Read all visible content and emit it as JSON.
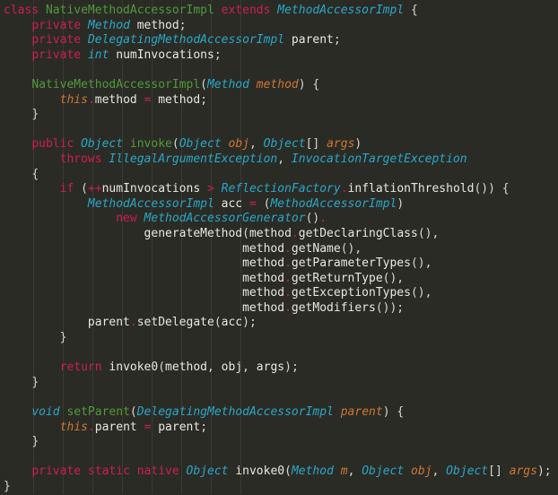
{
  "editor": {
    "background": "#2b2b26",
    "language": "java",
    "class_name": "NativeMethodAccessorImpl",
    "colors": {
      "background": "#2b2b26",
      "keyword": "#cc1f4f",
      "type": "#29a8c7",
      "method_declaration": "#4e9a3a",
      "parameter": "#cc7832",
      "plain_text": "#e8e8e0",
      "operator": "#cc1f4f",
      "indent_guide": "#3a3a33"
    },
    "indent_guide_columns": [
      4,
      8,
      12,
      16,
      20,
      24,
      28,
      32
    ]
  },
  "lines": [
    [
      [
        "kw",
        "class"
      ],
      [
        "tx",
        " "
      ],
      [
        "fn",
        "NativeMethodAccessorImpl"
      ],
      [
        "tx",
        " "
      ],
      [
        "kw",
        "extends"
      ],
      [
        "tx",
        " "
      ],
      [
        "ty",
        "MethodAccessorImpl"
      ],
      [
        "tx",
        " "
      ],
      [
        "pn",
        "{"
      ]
    ],
    [
      [
        "tx",
        "    "
      ],
      [
        "kw",
        "private"
      ],
      [
        "tx",
        " "
      ],
      [
        "ty",
        "Method"
      ],
      [
        "tx",
        " method"
      ],
      [
        "pn",
        ";"
      ]
    ],
    [
      [
        "tx",
        "    "
      ],
      [
        "kw",
        "private"
      ],
      [
        "tx",
        " "
      ],
      [
        "ty",
        "DelegatingMethodAccessorImpl"
      ],
      [
        "tx",
        " parent"
      ],
      [
        "pn",
        ";"
      ]
    ],
    [
      [
        "tx",
        "    "
      ],
      [
        "kw",
        "private"
      ],
      [
        "tx",
        " "
      ],
      [
        "ty",
        "int"
      ],
      [
        "tx",
        " numInvocations"
      ],
      [
        "pn",
        ";"
      ]
    ],
    [],
    [
      [
        "tx",
        "    "
      ],
      [
        "fn",
        "NativeMethodAccessorImpl"
      ],
      [
        "pn",
        "("
      ],
      [
        "ty",
        "Method"
      ],
      [
        "tx",
        " "
      ],
      [
        "pm",
        "method"
      ],
      [
        "pn",
        ")"
      ],
      [
        "tx",
        " "
      ],
      [
        "pn",
        "{"
      ]
    ],
    [
      [
        "tx",
        "        "
      ],
      [
        "pm",
        "this"
      ],
      [
        "op",
        "."
      ],
      [
        "tx",
        "method "
      ],
      [
        "op",
        "="
      ],
      [
        "tx",
        " method"
      ],
      [
        "pn",
        ";"
      ]
    ],
    [
      [
        "tx",
        "    "
      ],
      [
        "pn",
        "}"
      ]
    ],
    [],
    [
      [
        "tx",
        "    "
      ],
      [
        "kw",
        "public"
      ],
      [
        "tx",
        " "
      ],
      [
        "ty",
        "Object"
      ],
      [
        "tx",
        " "
      ],
      [
        "fn",
        "invoke"
      ],
      [
        "pn",
        "("
      ],
      [
        "ty",
        "Object"
      ],
      [
        "tx",
        " "
      ],
      [
        "pm",
        "obj"
      ],
      [
        "pn",
        ","
      ],
      [
        "tx",
        " "
      ],
      [
        "ty",
        "Object"
      ],
      [
        "pn",
        "[]"
      ],
      [
        "tx",
        " "
      ],
      [
        "pm",
        "args"
      ],
      [
        "pn",
        ")"
      ]
    ],
    [
      [
        "tx",
        "        "
      ],
      [
        "kw",
        "throws"
      ],
      [
        "tx",
        " "
      ],
      [
        "ty",
        "IllegalArgumentException"
      ],
      [
        "pn",
        ","
      ],
      [
        "tx",
        " "
      ],
      [
        "ty",
        "InvocationTargetException"
      ]
    ],
    [
      [
        "tx",
        "    "
      ],
      [
        "pn",
        "{"
      ]
    ],
    [
      [
        "tx",
        "        "
      ],
      [
        "kw",
        "if"
      ],
      [
        "tx",
        " "
      ],
      [
        "pn",
        "("
      ],
      [
        "op",
        "++"
      ],
      [
        "tx",
        "numInvocations "
      ],
      [
        "op",
        ">"
      ],
      [
        "tx",
        " "
      ],
      [
        "ty",
        "ReflectionFactory"
      ],
      [
        "op",
        "."
      ],
      [
        "tx",
        "inflationThreshold"
      ],
      [
        "pn",
        "())"
      ],
      [
        "tx",
        " "
      ],
      [
        "pn",
        "{"
      ]
    ],
    [
      [
        "tx",
        "            "
      ],
      [
        "ty",
        "MethodAccessorImpl"
      ],
      [
        "tx",
        " acc "
      ],
      [
        "op",
        "="
      ],
      [
        "tx",
        " "
      ],
      [
        "pn",
        "("
      ],
      [
        "ty",
        "MethodAccessorImpl"
      ],
      [
        "pn",
        ")"
      ]
    ],
    [
      [
        "tx",
        "                "
      ],
      [
        "kw",
        "new"
      ],
      [
        "tx",
        " "
      ],
      [
        "ty",
        "MethodAccessorGenerator"
      ],
      [
        "pn",
        "()"
      ],
      [
        "op",
        "."
      ]
    ],
    [
      [
        "tx",
        "                    "
      ],
      [
        "tx",
        "generateMethod"
      ],
      [
        "pn",
        "("
      ],
      [
        "tx",
        "method"
      ],
      [
        "op",
        "."
      ],
      [
        "tx",
        "getDeclaringClass"
      ],
      [
        "pn",
        "(),"
      ]
    ],
    [
      [
        "tx",
        "                                  "
      ],
      [
        "tx",
        "method"
      ],
      [
        "op",
        "."
      ],
      [
        "tx",
        "getName"
      ],
      [
        "pn",
        "(),"
      ]
    ],
    [
      [
        "tx",
        "                                  "
      ],
      [
        "tx",
        "method"
      ],
      [
        "op",
        "."
      ],
      [
        "tx",
        "getParameterTypes"
      ],
      [
        "pn",
        "(),"
      ]
    ],
    [
      [
        "tx",
        "                                  "
      ],
      [
        "tx",
        "method"
      ],
      [
        "op",
        "."
      ],
      [
        "tx",
        "getReturnType"
      ],
      [
        "pn",
        "(),"
      ]
    ],
    [
      [
        "tx",
        "                                  "
      ],
      [
        "tx",
        "method"
      ],
      [
        "op",
        "."
      ],
      [
        "tx",
        "getExceptionTypes"
      ],
      [
        "pn",
        "(),"
      ]
    ],
    [
      [
        "tx",
        "                                  "
      ],
      [
        "tx",
        "method"
      ],
      [
        "op",
        "."
      ],
      [
        "tx",
        "getModifiers"
      ],
      [
        "pn",
        "());"
      ]
    ],
    [
      [
        "tx",
        "            "
      ],
      [
        "tx",
        "parent"
      ],
      [
        "op",
        "."
      ],
      [
        "tx",
        "setDelegate"
      ],
      [
        "pn",
        "("
      ],
      [
        "tx",
        "acc"
      ],
      [
        "pn",
        ");"
      ]
    ],
    [
      [
        "tx",
        "        "
      ],
      [
        "pn",
        "}"
      ]
    ],
    [],
    [
      [
        "tx",
        "        "
      ],
      [
        "kw",
        "return"
      ],
      [
        "tx",
        " invoke0"
      ],
      [
        "pn",
        "("
      ],
      [
        "tx",
        "method"
      ],
      [
        "pn",
        ","
      ],
      [
        "tx",
        " obj"
      ],
      [
        "pn",
        ","
      ],
      [
        "tx",
        " args"
      ],
      [
        "pn",
        ");"
      ]
    ],
    [
      [
        "tx",
        "    "
      ],
      [
        "pn",
        "}"
      ]
    ],
    [],
    [
      [
        "tx",
        "    "
      ],
      [
        "ty",
        "void"
      ],
      [
        "tx",
        " "
      ],
      [
        "fn",
        "setParent"
      ],
      [
        "pn",
        "("
      ],
      [
        "ty",
        "DelegatingMethodAccessorImpl"
      ],
      [
        "tx",
        " "
      ],
      [
        "pm",
        "parent"
      ],
      [
        "pn",
        ")"
      ],
      [
        "tx",
        " "
      ],
      [
        "pn",
        "{"
      ]
    ],
    [
      [
        "tx",
        "        "
      ],
      [
        "pm",
        "this"
      ],
      [
        "op",
        "."
      ],
      [
        "tx",
        "parent "
      ],
      [
        "op",
        "="
      ],
      [
        "tx",
        " parent"
      ],
      [
        "pn",
        ";"
      ]
    ],
    [
      [
        "tx",
        "    "
      ],
      [
        "pn",
        "}"
      ]
    ],
    [],
    [
      [
        "tx",
        "    "
      ],
      [
        "kw",
        "private"
      ],
      [
        "tx",
        " "
      ],
      [
        "kw",
        "static"
      ],
      [
        "tx",
        " "
      ],
      [
        "kw",
        "native"
      ],
      [
        "tx",
        " "
      ],
      [
        "ty",
        "Object"
      ],
      [
        "tx",
        " invoke0"
      ],
      [
        "pn",
        "("
      ],
      [
        "ty",
        "Method"
      ],
      [
        "tx",
        " "
      ],
      [
        "pm",
        "m"
      ],
      [
        "pn",
        ","
      ],
      [
        "tx",
        " "
      ],
      [
        "ty",
        "Object"
      ],
      [
        "tx",
        " "
      ],
      [
        "pm",
        "obj"
      ],
      [
        "pn",
        ","
      ],
      [
        "tx",
        " "
      ],
      [
        "ty",
        "Object"
      ],
      [
        "pn",
        "[]"
      ],
      [
        "tx",
        " "
      ],
      [
        "pm",
        "args"
      ],
      [
        "pn",
        ");"
      ]
    ],
    [
      [
        "pn",
        "}"
      ]
    ]
  ]
}
